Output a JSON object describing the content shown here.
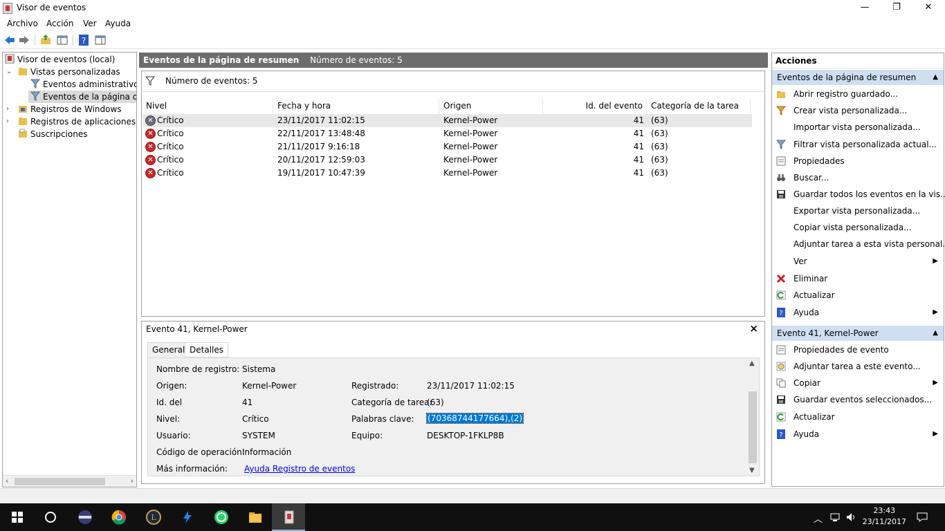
{
  "window": {
    "title": "Visor de eventos",
    "controls": {
      "minimize": "—",
      "maximize": "❐",
      "close": "✕"
    }
  },
  "menu": [
    "Archivo",
    "Acción",
    "Ver",
    "Ayuda"
  ],
  "tree": {
    "items": [
      {
        "label": "Visor de eventos (local)"
      },
      {
        "label": "Vistas personalizadas"
      },
      {
        "label": "Eventos administrativos"
      },
      {
        "label": "Eventos de la página de r"
      },
      {
        "label": "Registros de Windows"
      },
      {
        "label": "Registros de aplicaciones y s"
      },
      {
        "label": "Suscripciones"
      }
    ]
  },
  "center": {
    "header_title": "Eventos de la página de resumen",
    "header_count": "Número de eventos: 5",
    "filter_text": "Número de eventos: 5",
    "columns": [
      "Nivel",
      "Fecha y hora",
      "Origen",
      "Id. del evento",
      "Categoría de la tarea"
    ],
    "rows": [
      {
        "level": "Crítico",
        "datetime": "23/11/2017 11:02:15",
        "source": "Kernel-Power",
        "id": "41",
        "category": "(63)"
      },
      {
        "level": "Crítico",
        "datetime": "22/11/2017 13:48:48",
        "source": "Kernel-Power",
        "id": "41",
        "category": "(63)"
      },
      {
        "level": "Crítico",
        "datetime": "21/11/2017 9:16:18",
        "source": "Kernel-Power",
        "id": "41",
        "category": "(63)"
      },
      {
        "level": "Crítico",
        "datetime": "20/11/2017 12:59:03",
        "source": "Kernel-Power",
        "id": "41",
        "category": "(63)"
      },
      {
        "level": "Crítico",
        "datetime": "19/11/2017 10:47:39",
        "source": "Kernel-Power",
        "id": "41",
        "category": "(63)"
      }
    ]
  },
  "detail": {
    "title": "Evento 41, Kernel-Power",
    "tabs": [
      "General",
      "Detalles"
    ],
    "fields": {
      "log_name_label": "Nombre de registro:",
      "log_name": "Sistema",
      "source_label": "Origen:",
      "source": "Kernel-Power",
      "logged_label": "Registrado:",
      "logged": "23/11/2017 11:02:15",
      "id_label": "Id. del",
      "id": "41",
      "task_label": "Categoría de tarea:",
      "task": "(63)",
      "level_label": "Nivel:",
      "level": "Crítico",
      "keywords_label": "Palabras clave:",
      "keywords": "(70368744177664),(2)",
      "user_label": "Usuario:",
      "user": "SYSTEM",
      "computer_label": "Equipo:",
      "computer": "DESKTOP-1FKLP8B",
      "opcode_label": "Código de operación:",
      "opcode": "Información",
      "more_label": "Más información:",
      "more_link": "Ayuda Registro de eventos"
    }
  },
  "actions": {
    "title": "Acciones",
    "section1": "Eventos de la página de resumen",
    "section1_items": [
      "Abrir registro guardado...",
      "Crear vista personalizada...",
      "Importar vista personalizada...",
      "Filtrar vista personalizada actual...",
      "Propiedades",
      "Buscar...",
      "Guardar todos los eventos en la vis...",
      "Exportar vista personalizada...",
      "Copiar vista personalizada...",
      "Adjuntar tarea a esta vista personal...",
      "Ver",
      "Eliminar",
      "Actualizar",
      "Ayuda"
    ],
    "section2": "Evento 41, Kernel-Power",
    "section2_items": [
      "Propiedades de evento",
      "Adjuntar tarea a este evento...",
      "Copiar",
      "Guardar eventos seleccionados...",
      "Actualizar",
      "Ayuda"
    ]
  },
  "taskbar": {
    "time": "23:43",
    "date": "23/11/2017"
  }
}
